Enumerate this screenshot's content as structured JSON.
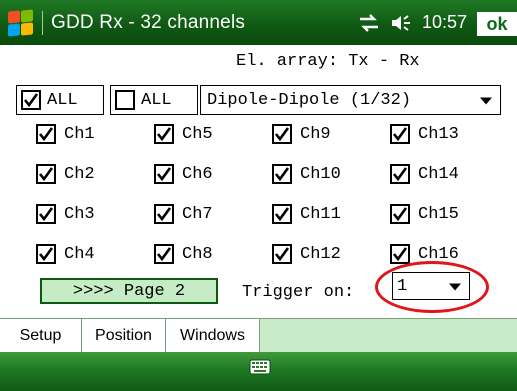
{
  "titlebar": {
    "title": "GDD Rx - 32 channels",
    "time": "10:57",
    "ok_label": "ok",
    "icons": [
      "windows-start-icon",
      "connectivity-icon",
      "speaker-icon"
    ]
  },
  "setup": {
    "array_label": "El. array: Tx - Rx",
    "all_checked_label": "ALL",
    "all_unchecked_label": "ALL",
    "array_select_value": "Dipole-Dipole (1/32)",
    "channels": [
      {
        "label": "Ch1",
        "checked": true
      },
      {
        "label": "Ch5",
        "checked": true
      },
      {
        "label": "Ch9",
        "checked": true
      },
      {
        "label": "Ch13",
        "checked": true
      },
      {
        "label": "Ch2",
        "checked": true
      },
      {
        "label": "Ch6",
        "checked": true
      },
      {
        "label": "Ch10",
        "checked": true
      },
      {
        "label": "Ch14",
        "checked": true
      },
      {
        "label": "Ch3",
        "checked": true
      },
      {
        "label": "Ch7",
        "checked": true
      },
      {
        "label": "Ch11",
        "checked": true
      },
      {
        "label": "Ch15",
        "checked": true
      },
      {
        "label": "Ch4",
        "checked": true
      },
      {
        "label": "Ch8",
        "checked": true
      },
      {
        "label": "Ch12",
        "checked": true
      },
      {
        "label": "Ch16",
        "checked": true
      }
    ],
    "page_button_label": ">>>> Page 2",
    "trigger_label": "Trigger on:",
    "trigger_value": "1"
  },
  "tabs": [
    {
      "label": "Setup",
      "active": true
    },
    {
      "label": "Position",
      "active": false
    },
    {
      "label": "Windows",
      "active": false
    }
  ],
  "colors": {
    "titlebar_green": "#0f5a13",
    "tab_strip": "#c8ecc8",
    "page_button_fill": "#c6ecc6",
    "highlight_ring": "#e0161b",
    "ok_text": "#0d6a1a"
  }
}
